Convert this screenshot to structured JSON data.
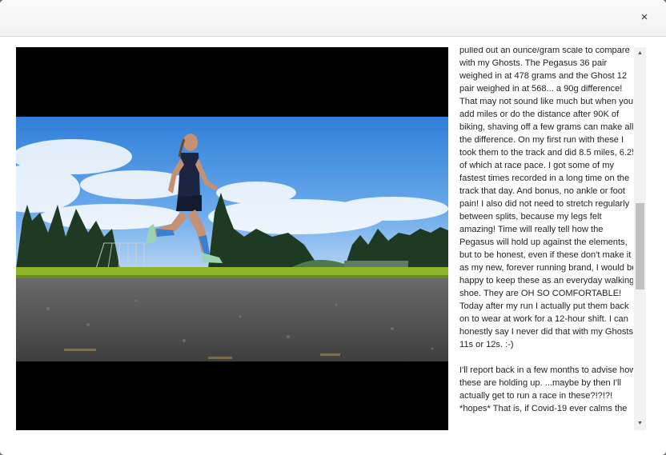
{
  "dialog": {
    "close_label": "×"
  },
  "review": {
    "paragraphs": [
      "Pegasus to weigh them against my Ghosts. I pulled out an ounce/gram scale to compare with my Ghosts. The Pegasus 36 pair weighed in at 478 grams and the Ghost 12 pair weighed in at 568... a 90g difference! That may not sound like much but when you add miles or do the distance after 90K of biking, shaving off a few grams can make all the difference. On my first run with these I took them to the track and did 8.5 miles, 6.25 of which at race pace. I got some of my fastest times recorded in a long time on the track that day. And bonus, no ankle or foot pain! I also did not need to stretch regularly between splits, because my legs felt amazing! Time will really tell how the Pegasus will hold up against the elements, but to be honest, even if these don't make it as my new, forever running brand, I would be happy to keep these as an everyday walking shoe. They are OH SO COMFORTABLE! Today after my run I actually put them back on to wear at work for a 12-hour shift. I can honestly say I never did that with my Ghosts 11s or 12s. :-)",
      "I'll report back in a few months to advise how these are holding up. ...maybe by then I'll actually get to run a race in these?!?!?! *hopes* That is, if Covid-19 ever calms the"
    ]
  },
  "scrollbar": {
    "up_arrow": "▲",
    "down_arrow": "▼",
    "position": 0.5
  },
  "colors": {
    "sky": "#3d8fe0",
    "track": "#4b4b4b",
    "grass": "#8fb52a",
    "socks": "#3a7fd0"
  }
}
